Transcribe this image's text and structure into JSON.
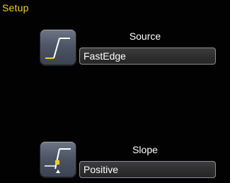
{
  "panel": {
    "title": "Setup"
  },
  "source": {
    "label": "Source",
    "value": "FastEdge",
    "icon": "rising-edge-trigger-icon"
  },
  "slope": {
    "label": "Slope",
    "value": "Positive",
    "icon": "positive-slope-icon"
  },
  "colors": {
    "title": "#f2d21a",
    "trace": "#f2d21a",
    "button": "#5a6374",
    "field": "#333333"
  }
}
